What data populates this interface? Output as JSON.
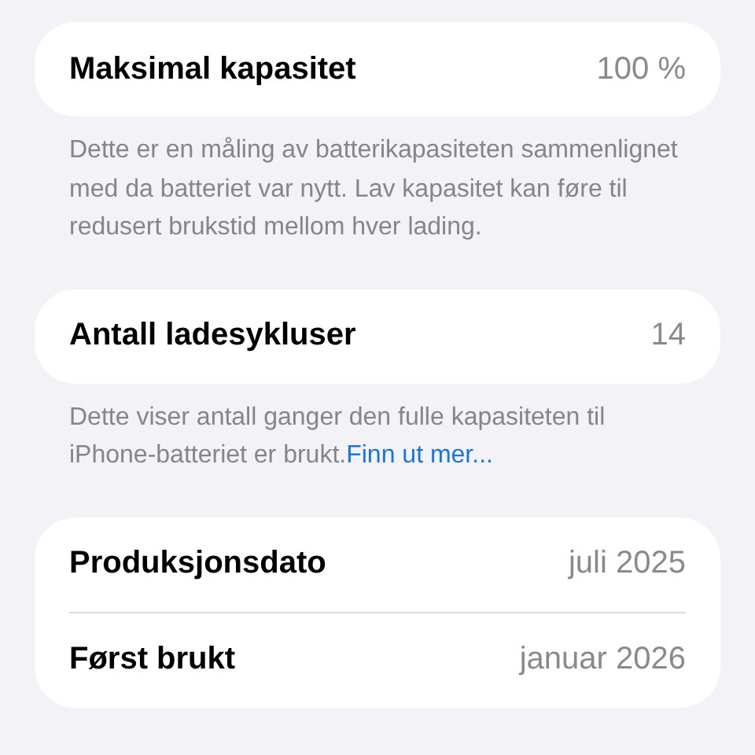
{
  "sections": [
    {
      "rows": [
        {
          "label": "Maksimal kapasitet",
          "value": "100 %"
        }
      ],
      "footer": {
        "text": "Dette er en måling av batterikapasiteten sammenlignet med da batteriet var nytt. Lav kapasitet kan føre til redusert brukstid mellom hver lading."
      }
    },
    {
      "rows": [
        {
          "label": "Antall ladesykluser",
          "value": "14"
        }
      ],
      "footer": {
        "text": "Dette viser antall ganger den fulle kapasiteten til iPhone-batteriet er brukt.",
        "link": "Finn ut mer..."
      }
    },
    {
      "rows": [
        {
          "label": "Produksjonsdato",
          "value": "juli 2025"
        },
        {
          "label": "Først brukt",
          "value": "januar 2026"
        }
      ]
    }
  ]
}
